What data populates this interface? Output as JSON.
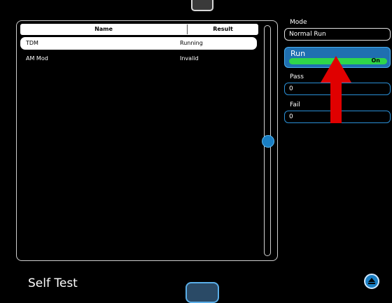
{
  "table": {
    "columns": {
      "name": "Name",
      "result": "Result"
    },
    "rows": [
      {
        "name": "TDM",
        "result": "Running",
        "selected": true
      },
      {
        "name": "AM Mod",
        "result": "Invalid",
        "selected": false
      }
    ]
  },
  "side": {
    "mode": {
      "label": "Mode",
      "value": "Normal Run"
    },
    "run": {
      "label": "Run",
      "state": "On"
    },
    "pass": {
      "label": "Pass",
      "value": "0"
    },
    "fail": {
      "label": "Fail",
      "value": "0"
    }
  },
  "footer": {
    "title": "Self Test"
  },
  "annotation": {
    "arrow_color": "#e00000"
  },
  "colors": {
    "accent": "#1f6fb0",
    "run_on": "#2fd64a"
  }
}
